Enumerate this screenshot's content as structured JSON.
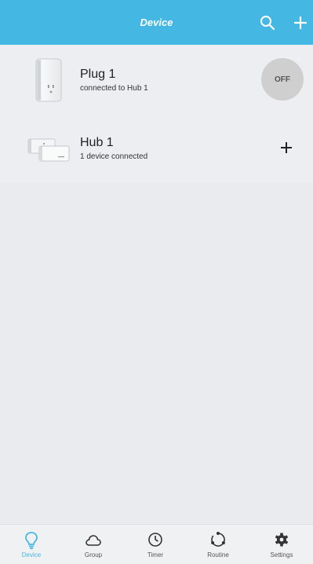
{
  "header": {
    "title": "Device",
    "search_icon": "search-icon",
    "add_icon": "plus-icon"
  },
  "devices": [
    {
      "name": "Plug 1",
      "status": "connected to Hub 1",
      "control": "OFF",
      "icon": "smart-plug-icon"
    },
    {
      "name": "Hub 1",
      "status": "1 device connected",
      "control_icon": "plus-icon",
      "icon": "hub-icon"
    }
  ],
  "tabs": [
    {
      "label": "Device",
      "icon": "bulb-icon",
      "active": true
    },
    {
      "label": "Group",
      "icon": "cloud-icon",
      "active": false
    },
    {
      "label": "Timer",
      "icon": "clock-icon",
      "active": false
    },
    {
      "label": "Routine",
      "icon": "routine-icon",
      "active": false
    },
    {
      "label": "Settings",
      "icon": "gear-icon",
      "active": false
    }
  ],
  "colors": {
    "accent": "#44b8e3",
    "background": "#e9ebee",
    "toggle_off": "#cfcfcf"
  }
}
